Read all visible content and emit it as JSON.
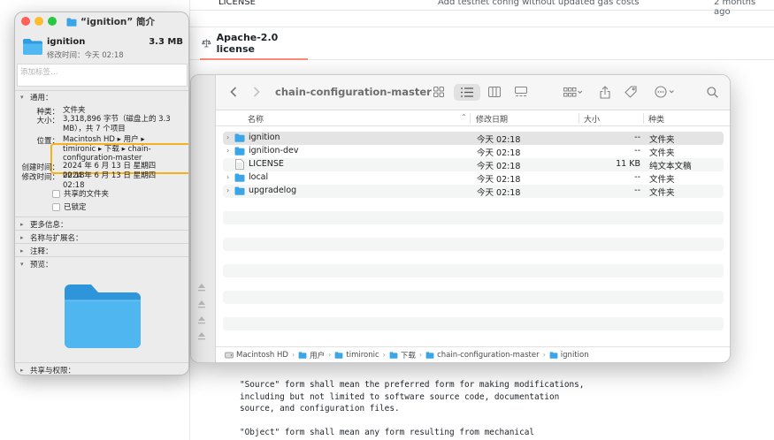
{
  "background": {
    "top_row": {
      "file": "LICENSE",
      "commit": "Add testnet config without updated gas costs",
      "age": "2 months ago"
    },
    "license_tab": "Apache-2.0 license",
    "license_lines": [
      "\"Source\" form shall mean the preferred form for making modifications,",
      "including but not limited to software source code, documentation",
      "source, and configuration files.",
      "\"Object\" form shall mean any form resulting from mechanical"
    ]
  },
  "finder": {
    "folder_title": "chain-configuration-master",
    "columns": {
      "name": "名称",
      "date": "修改日期",
      "size": "大小",
      "kind": "种类"
    },
    "rows": [
      {
        "name": "ignition",
        "date": "今天 02:18",
        "size": "--",
        "kind": "文件夹",
        "type": "folder"
      },
      {
        "name": "ignition-dev",
        "date": "今天 02:18",
        "size": "--",
        "kind": "文件夹",
        "type": "folder"
      },
      {
        "name": "LICENSE",
        "date": "今天 02:18",
        "size": "11 KB",
        "kind": "纯文本文稿",
        "type": "file"
      },
      {
        "name": "local",
        "date": "今天 02:18",
        "size": "--",
        "kind": "文件夹",
        "type": "folder"
      },
      {
        "name": "upgradelog",
        "date": "今天 02:18",
        "size": "--",
        "kind": "文件夹",
        "type": "folder"
      }
    ],
    "path": [
      "Macintosh HD",
      "用户",
      "timironic",
      "下载",
      "chain-configuration-master",
      "ignition"
    ]
  },
  "info": {
    "window_title": "“ignition” 简介",
    "name": "ignition",
    "size": "3.3 MB",
    "modified_short": "修改时间：今天 02:18",
    "tags_placeholder": "添加标签…",
    "general_heading": "通用：",
    "kind_label": "种类：",
    "kind_value": "文件夹",
    "size_label": "大小：",
    "size_value": "3,318,896 字节（磁盘上的 3.3 MB），共 7 个项目",
    "where_label": "位置：",
    "where_value": "Macintosh HD ▸ 用户 ▸ timironic ▸ 下载 ▸ chain-configuration-master",
    "created_label": "创建时间：",
    "created_value": "2024 年 6 月 13 日 星期四 02:18",
    "modified_label": "修改时间：",
    "modified_value": "2024 年 6 月 13 日 星期四 02:18",
    "shared_folder": "共享的文件夹",
    "locked": "已锁定",
    "more_info": "更多信息：",
    "name_ext": "名称与扩展名：",
    "comments": "注释：",
    "preview": "预览：",
    "sharing": "共享与权限："
  },
  "colors": {
    "folder": "#3aa6e8",
    "close": "#ff5f57",
    "minimize": "#febc2e",
    "zoom": "#28c840",
    "highlight": "#f5b21a"
  }
}
